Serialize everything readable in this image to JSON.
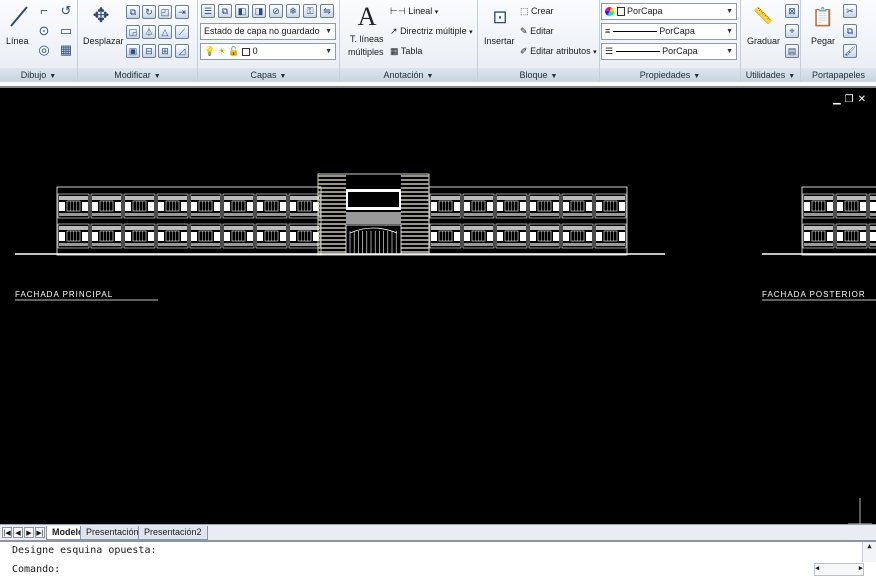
{
  "ribbon": {
    "dibujo": {
      "title": "Dibujo",
      "linea": "Línea"
    },
    "modificar": {
      "title": "Modificar",
      "desplazar": "Desplazar"
    },
    "capas": {
      "title": "Capas",
      "layer_state": "Estado de capa no guardado",
      "current_layer": "0"
    },
    "anotacion": {
      "title": "Anotación",
      "mtext_line1": "T. líneas",
      "mtext_line2": "múltiples",
      "lineal": "Lineal",
      "directriz": "Directriz múltiple",
      "tabla": "Tabla"
    },
    "bloque": {
      "title": "Bloque",
      "insertar": "Insertar",
      "crear": "Crear",
      "editar": "Editar",
      "editar_atributos": "Editar atributos"
    },
    "propiedades": {
      "title": "Propiedades",
      "color": "PorCapa",
      "linetype": "PorCapa",
      "lineweight": "PorCapa"
    },
    "utilidades": {
      "title": "Utilidades",
      "graduar": "Graduar"
    },
    "portapapeles": {
      "title": "Portapapeles",
      "pegar": "Pegar"
    }
  },
  "drawing": {
    "label_front": "FACHADA PRINCIPAL",
    "label_back": "FACHADA POSTERIOR"
  },
  "tabs": [
    "Modelo",
    "Presentación1",
    "Presentación2"
  ],
  "command": {
    "history": "Designe esquina opuesta:",
    "prompt": "Comando:"
  },
  "colors": {
    "workspace": "#000000",
    "lines": "#ffffff",
    "accent": "#2a4c78"
  }
}
